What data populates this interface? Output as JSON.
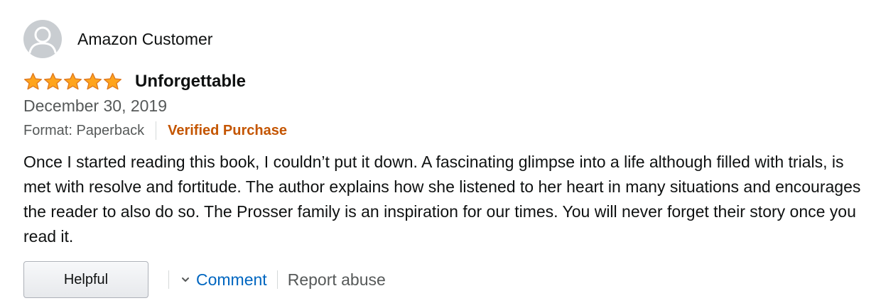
{
  "reviewer": {
    "name": "Amazon Customer",
    "avatar_icon": "user-silhouette-icon"
  },
  "review": {
    "rating": 5,
    "rating_max": 5,
    "star_color": "#ffa41c",
    "title": "Unforgettable",
    "date": "December 30, 2019",
    "format": "Format: Paperback",
    "verified": "Verified Purchase",
    "verified_color": "#c45500",
    "body": "Once I started reading this book, I couldn’t put it down. A fascinating glimpse into a life although filled with trials, is met with resolve and fortitude. The author explains how she listened to her heart in many situations and encourages the reader to also do so. The Prosser family is an inspiration for our times. You will never forget their story once you read it."
  },
  "actions": {
    "helpful_label": "Helpful",
    "comment_label": "Comment",
    "comment_icon": "chevron-down-icon",
    "report_label": "Report abuse",
    "link_color": "#0066c0"
  }
}
